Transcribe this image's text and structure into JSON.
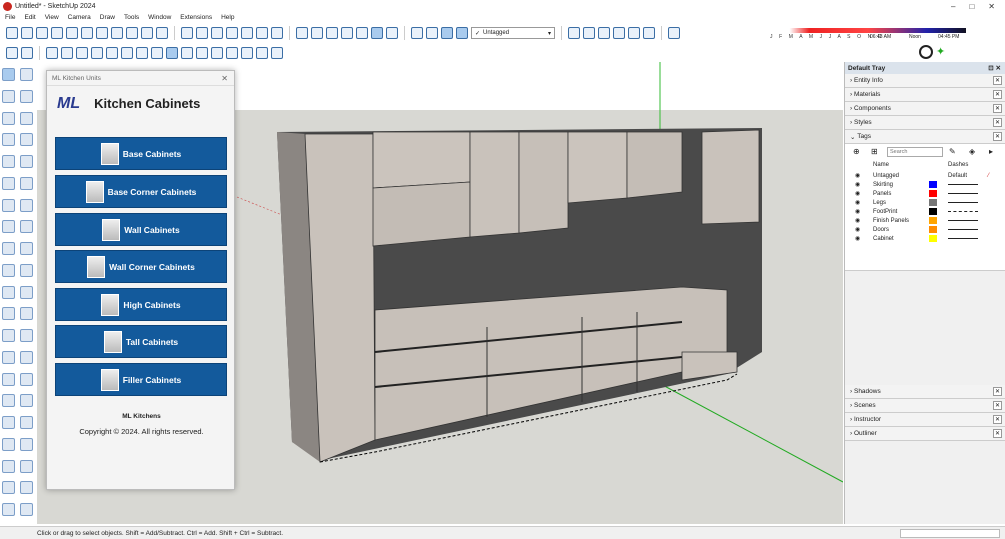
{
  "window": {
    "title": "Untitled* - SketchUp 2024"
  },
  "menu": [
    "File",
    "Edit",
    "View",
    "Camera",
    "Draw",
    "Tools",
    "Window",
    "Extensions",
    "Help"
  ],
  "tag_select": {
    "value": "Untagged"
  },
  "shadow": {
    "months": "J F M A M J J A S O N D",
    "time_start": "06:43 AM",
    "noon": "Noon",
    "time_end": "04:45 PM"
  },
  "panel": {
    "title": "ML Kitchen Units",
    "logo": "ML",
    "heading": "Kitchen Cabinets",
    "buttons": [
      "Base Cabinets",
      "Base Corner Cabinets",
      "Wall Cabinets",
      "Wall Corner Cabinets",
      "High Cabinets",
      "Tall Cabinets",
      "Filler Cabinets"
    ],
    "company": "ML Kitchens",
    "copyright": "Copyright © 2024. All rights reserved."
  },
  "tray": {
    "title": "Default Tray",
    "sections_top": [
      "Entity Info",
      "Materials",
      "Components",
      "Styles",
      "Tags"
    ],
    "search_placeholder": "Search",
    "tag_columns": {
      "name": "Name",
      "dashes": "Dashes"
    },
    "tags": [
      {
        "name": "Untagged",
        "color": "",
        "dashes": "Default"
      },
      {
        "name": "Skirting",
        "color": "#0000ff",
        "dashes": ""
      },
      {
        "name": "Panels",
        "color": "#ff0000",
        "dashes": ""
      },
      {
        "name": "Legs",
        "color": "#777777",
        "dashes": ""
      },
      {
        "name": "FootPrint",
        "color": "#000000",
        "dashes": ""
      },
      {
        "name": "Finish Panels",
        "color": "#ffa500",
        "dashes": ""
      },
      {
        "name": "Doors",
        "color": "#ff8c00",
        "dashes": ""
      },
      {
        "name": "Cabinet",
        "color": "#ffff00",
        "dashes": ""
      }
    ],
    "sections_bottom": [
      "Shadows",
      "Scenes",
      "Instructor",
      "Outliner"
    ]
  },
  "status": {
    "text": "Click or drag to select objects. Shift = Add/Subtract. Ctrl = Add. Shift + Ctrl = Subtract."
  },
  "colors": {
    "accent": "#135a9c",
    "wood": "#c9c2bb"
  }
}
